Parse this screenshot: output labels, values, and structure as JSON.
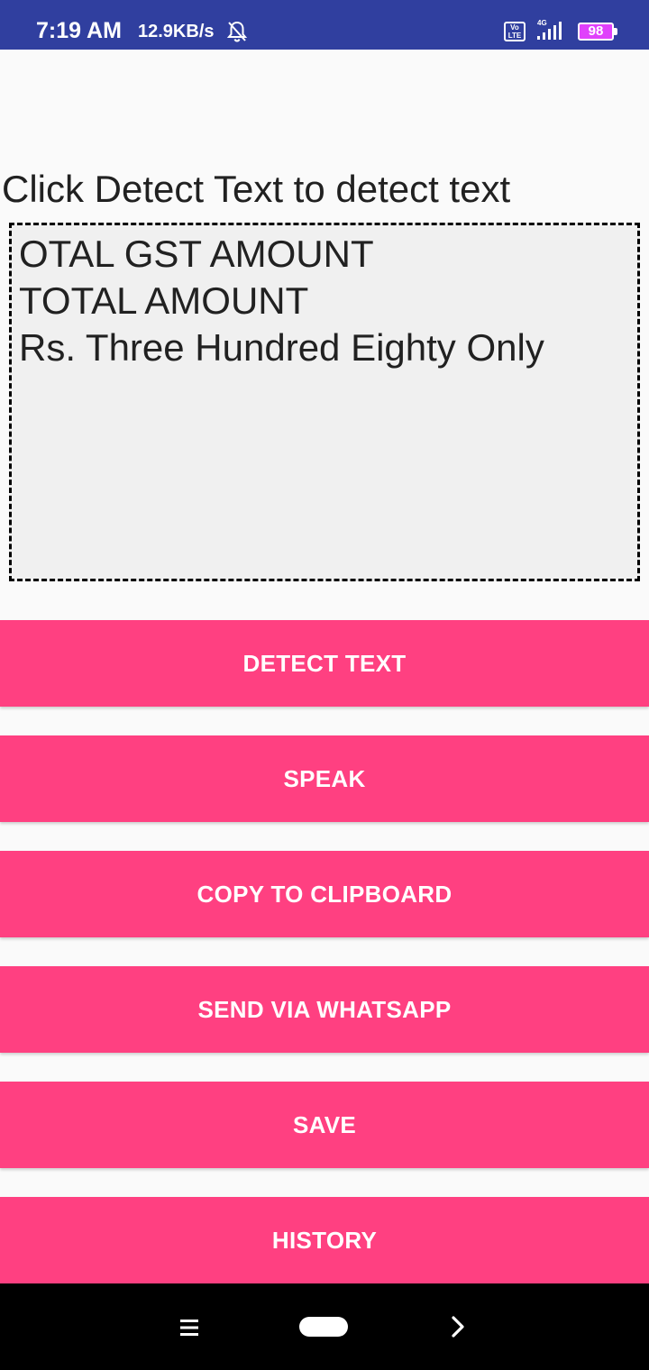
{
  "status_bar": {
    "time": "7:19 AM",
    "speed": "12.9KB/s",
    "volte_label": "Vo LTE",
    "network": "4G",
    "battery": "98",
    "bell_icon": "bell-off-icon",
    "color": "#303f9f"
  },
  "main": {
    "instruction": "Click Detect Text to detect text",
    "detected_lines": [
      "OTAL GST AMOUNT",
      "TOTAL AMOUNT",
      "Rs. Three Hundred Eighty Only"
    ]
  },
  "buttons": {
    "detect": "DETECT TEXT",
    "speak": "SPEAK",
    "copy": "COPY TO CLIPBOARD",
    "whatsapp": "SEND VIA WHATSAPP",
    "save": "SAVE",
    "history": "HISTORY",
    "color": "#ff4081"
  },
  "nav_bar": {
    "menu_icon": "menu-icon",
    "home_icon": "home-pill-icon",
    "back_icon": "chevron-right-icon"
  }
}
